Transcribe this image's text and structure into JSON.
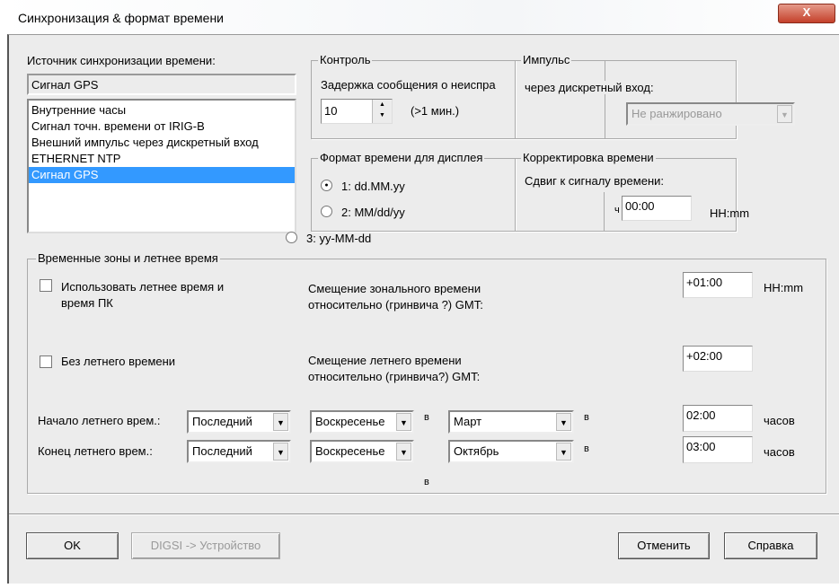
{
  "window": {
    "title": "Синхронизация & формат времени",
    "close_label": "X"
  },
  "source": {
    "label": "Источник синхронизации времени:",
    "current": "Сигнал GPS",
    "options": [
      "Внутренние часы",
      "Сигнал точн. времени от IRIG-B",
      "Внешний импульс через дискретный вход",
      "ETHERNET NTP",
      "Сигнал GPS"
    ],
    "selected_index": 4
  },
  "control": {
    "title": "Контроль",
    "delay_label": "Задержка сообщения о неиспра",
    "delay_value": "10",
    "delay_hint": "(>1 мин.)"
  },
  "impulse": {
    "title": "Импульс",
    "input_label": "через дискретный вход:",
    "input_value": "Не ранжировано"
  },
  "format": {
    "title": "Формат времени для дисплея",
    "options": [
      "1: dd.MM.yy",
      "2: MM/dd/yy",
      "3: yy-MM-dd"
    ],
    "selected_index": 0
  },
  "correction": {
    "title": "Корректировка времени",
    "shift_label": "Сдвиг к сигналу времени:",
    "prefix": "ч",
    "shift_value": "00:00",
    "unit": "HH:mm"
  },
  "zones": {
    "title": "Временные зоны и летнее время",
    "use_dst_label": "Использовать летнее время и",
    "use_dst_label2": "время ПК",
    "use_dst_checked": false,
    "no_dst_label": "Без летнего времени",
    "no_dst_checked": false,
    "zone_offset_label": "Смещение зонального времени",
    "zone_offset_label2": "относительно (гринвича ?) GMT:",
    "zone_offset_value": "+01:00",
    "zone_offset_unit": "HH:mm",
    "dst_offset_label": "Смещение летнего времени",
    "dst_offset_label2": "относительно (гринвича?) GMT:",
    "dst_offset_value": "+02:00",
    "start": {
      "label": "Начало летнего врем.:",
      "week": "Последний",
      "day": "Воскресенье",
      "in1": "в",
      "month": "Март",
      "in2": "в",
      "time": "02:00",
      "unit": "часов"
    },
    "end": {
      "label": "Конец летнего врем.:",
      "week": "Последний",
      "day": "Воскресенье",
      "month": "Октябрь",
      "in2": "в",
      "time": "03:00",
      "unit": "часов"
    },
    "stray_in": "в"
  },
  "buttons": {
    "ok": "OK",
    "digsi": "DIGSI -> Устройство",
    "cancel": "Отменить",
    "help": "Справка"
  }
}
